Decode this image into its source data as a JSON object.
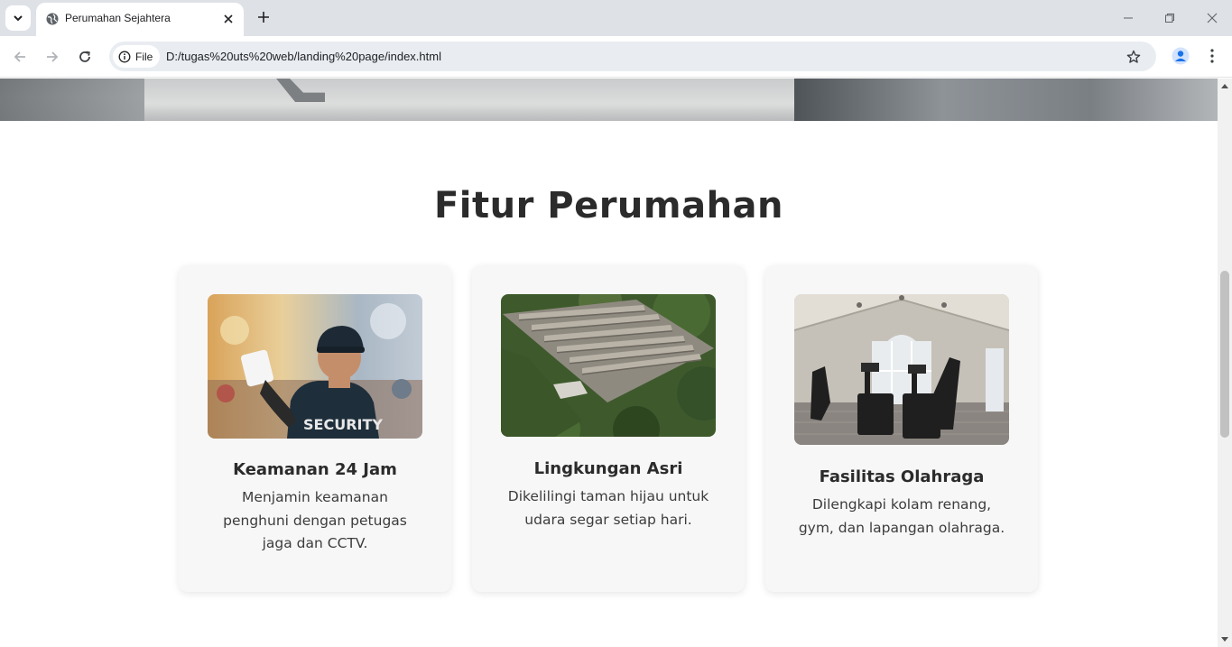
{
  "browser": {
    "tab_title": "Perumahan Sejahtera",
    "site_chip_label": "File",
    "url": "D:/tugas%20uts%20web/landing%20page/index.html",
    "icons": {
      "tab_search": "chevron-down-icon",
      "favicon": "globe-icon",
      "tab_close": "close-icon",
      "new_tab": "plus-icon",
      "back": "arrow-left-icon",
      "forward": "arrow-right-icon",
      "reload": "reload-icon",
      "site_info": "info-icon",
      "bookmark": "star-icon",
      "profile": "person-icon",
      "menu": "kebab-menu-icon",
      "minimize": "minimize-icon",
      "restore": "restore-icon",
      "close_window": "close-icon"
    }
  },
  "page": {
    "section_title": "Fitur Perumahan",
    "features": [
      {
        "title": "Keamanan 24 Jam",
        "description": "Menjamin keamanan penghuni dengan petugas jaga dan CCTV.",
        "image_text": "SECURITY"
      },
      {
        "title": "Lingkungan Asri",
        "description": "Dikelilingi taman hijau untuk udara segar setiap hari."
      },
      {
        "title": "Fasilitas Olahraga",
        "description": "Dilengkapi kolam renang, gym, dan lapangan olahraga."
      }
    ]
  },
  "colors": {
    "heading": "#2b2b2b",
    "card_background": "#f7f7f7",
    "tabstrip": "#dee1e6",
    "omnibox": "#e9edf2",
    "profile_accent": "#1a73e8"
  }
}
